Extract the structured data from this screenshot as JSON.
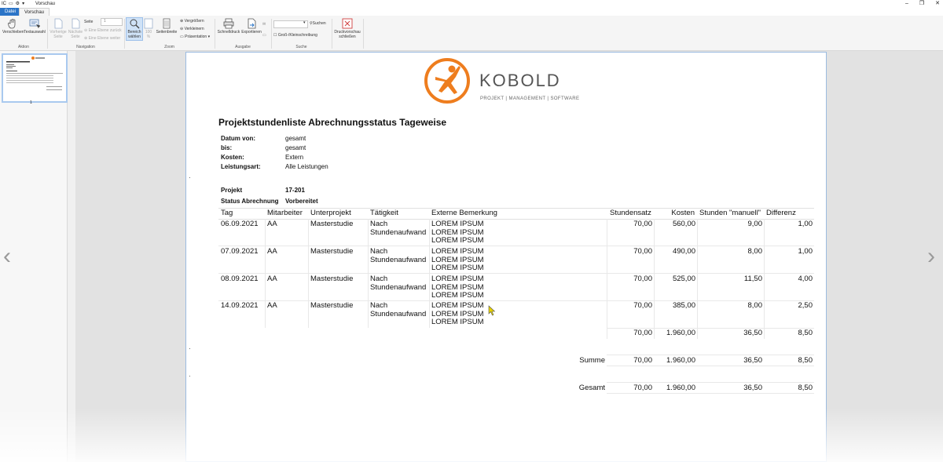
{
  "window": {
    "title": "Vorschau",
    "app_prefix": "IC",
    "controls": [
      "–",
      "❐",
      "✕"
    ]
  },
  "tabs": {
    "file": "Datei",
    "active": "Vorschau"
  },
  "ribbon": {
    "verschieben": "Verschieben",
    "textauswahl": "Textauswahl",
    "vorherige_seite": "Vorherige Seite",
    "naechste_seite": "Nächste Seite",
    "seite_label": "Seite",
    "seite_value": "1",
    "eine_ebene_zurueck": "Eine Ebene zurück",
    "eine_ebene_weiter": "Eine Ebene weiter",
    "bereich_waehlen": "Bereich wählen",
    "zoom_100": "100 %",
    "seitenbreite": "Seitenbreite",
    "vergroessern": "Vergrößern",
    "verkleinern": "Verkleinern",
    "praesentation": "Präsentation",
    "schnelldruck": "Schnelldruck",
    "exportieren": "Exportieren",
    "suchen": "Suchen",
    "gross_klein": "Groß-/Kleinschreibung",
    "druckvorschau_schliessen": "Druckvorschau schließen",
    "groups": {
      "aktion": "Aktion",
      "navigation": "Navigation",
      "zoom": "Zoom",
      "ausgabe": "Ausgabe",
      "suche": "Suche"
    }
  },
  "sidebar": {
    "page_number": "1"
  },
  "logo": {
    "name": "KOBOLD",
    "tagline": "PROJEKT | MANAGEMENT | SOFTWARE"
  },
  "report": {
    "title": "Projektstundenliste Abrechnungsstatus Tageweise",
    "meta": [
      {
        "k": "Datum von:",
        "v": "gesamt"
      },
      {
        "k": "bis:",
        "v": "gesamt"
      },
      {
        "k": "Kosten:",
        "v": "Extern"
      },
      {
        "k": "Leistungsart:",
        "v": "Alle Leistungen"
      }
    ],
    "projekt_label": "Projekt",
    "projekt_value": "17-201",
    "status_label": "Status Abrechnung",
    "status_value": "Vorbereitet",
    "columns": [
      "Tag",
      "Mitarbeiter",
      "Unterprojekt",
      "Tätigkeit",
      "Externe Bemerkung",
      "Stundensatz",
      "Kosten",
      "Stunden \"manuell\"",
      "Differenz"
    ],
    "rows": [
      {
        "tag": "06.09.2021",
        "ma": "AA",
        "up": "Masterstudie",
        "t1": "Nach",
        "t2": "Stundenaufwand",
        "b1": "LOREM IPSUM",
        "b2": "LOREM IPSUM",
        "b3": "LOREM IPSUM",
        "satz": "70,00",
        "kosten": "560,00",
        "std": "9,00",
        "diff": "1,00"
      },
      {
        "tag": "07.09.2021",
        "ma": "AA",
        "up": "Masterstudie",
        "t1": "Nach",
        "t2": "Stundenaufwand",
        "b1": "LOREM IPSUM",
        "b2": "LOREM IPSUM",
        "b3": "LOREM IPSUM",
        "satz": "70,00",
        "kosten": "490,00",
        "std": "8,00",
        "diff": "1,00"
      },
      {
        "tag": "08.09.2021",
        "ma": "AA",
        "up": "Masterstudie",
        "t1": "Nach",
        "t2": "Stundenaufwand",
        "b1": "LOREM IPSUM",
        "b2": "LOREM IPSUM",
        "b3": "LOREM IPSUM",
        "satz": "70,00",
        "kosten": "525,00",
        "std": "11,50",
        "diff": "4,00"
      },
      {
        "tag": "14.09.2021",
        "ma": "AA",
        "up": "Masterstudie",
        "t1": "Nach",
        "t2": "Stundenaufwand",
        "b1": "LOREM IPSUM",
        "b2": "LOREM IPSUM",
        "b3": "LOREM IPSUM",
        "satz": "70,00",
        "kosten": "385,00",
        "std": "8,00",
        "diff": "2,50"
      }
    ],
    "subtotal": {
      "satz": "70,00",
      "kosten": "1.960,00",
      "std": "36,50",
      "diff": "8,50"
    },
    "summe": {
      "label": "Summe",
      "satz": "70,00",
      "kosten": "1.960,00",
      "std": "36,50",
      "diff": "8,50"
    },
    "gesamt": {
      "label": "Gesamt",
      "satz": "70,00",
      "kosten": "1.960,00",
      "std": "36,50",
      "diff": "8,50"
    }
  },
  "colors": {
    "accent": "#2b74c7",
    "logo_orange": "#ee7d1e",
    "cursor": "#e8d200"
  }
}
